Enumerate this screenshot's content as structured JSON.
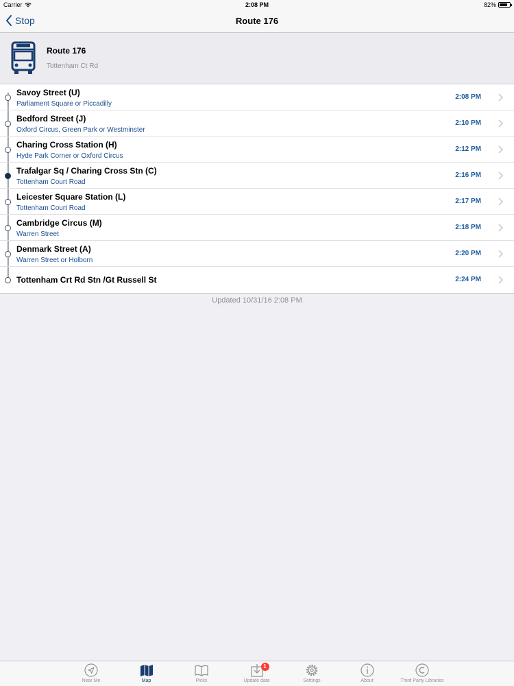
{
  "status_bar": {
    "carrier": "Carrier",
    "time": "2:08 PM",
    "battery_percent": "82%",
    "battery_level": 0.82
  },
  "nav": {
    "back_label": "Stop",
    "title": "Route 176"
  },
  "route": {
    "name": "Route 176",
    "destination": "Tottenham Ct Rd",
    "icon": "bus-icon"
  },
  "stops": [
    {
      "name": "Savoy Street (U)",
      "towards": "Parliament Square or Piccadilly",
      "time": "2:08 PM"
    },
    {
      "name": "Bedford Street (J)",
      "towards": "Oxford Circus, Green Park or Westminster",
      "time": "2:10 PM"
    },
    {
      "name": "Charing Cross Station (H)",
      "towards": "Hyde Park Corner or Oxford Circus",
      "time": "2:12 PM"
    },
    {
      "name": "Trafalgar Sq / Charing Cross Stn (C)",
      "towards": "Tottenham Court Road",
      "time": "2:16 PM",
      "current": true
    },
    {
      "name": "Leicester Square Station (L)",
      "towards": "Tottenham Court Road",
      "time": "2:17 PM"
    },
    {
      "name": "Cambridge Circus (M)",
      "towards": "Warren Street",
      "time": "2:18 PM"
    },
    {
      "name": "Denmark Street (A)",
      "towards": "Warren Street or Holborn",
      "time": "2:20 PM"
    },
    {
      "name": "Tottenham Crt Rd Stn /Gt Russell St",
      "towards": "",
      "time": "2:24 PM"
    }
  ],
  "updated_text": "Updated 10/31/16 2:08 PM",
  "tabs": [
    {
      "label": "Near Me",
      "icon": "location-arrow-icon"
    },
    {
      "label": "Map",
      "icon": "map-icon",
      "active": true
    },
    {
      "label": "Picks",
      "icon": "book-icon"
    },
    {
      "label": "Update data",
      "icon": "download-icon",
      "badge": "1"
    },
    {
      "label": "Settings",
      "icon": "gear-icon"
    },
    {
      "label": "About",
      "icon": "info-icon"
    },
    {
      "label": "Third Party Libraries",
      "icon": "copyright-icon"
    }
  ],
  "colors": {
    "accent": "#1a4d8f",
    "time_blue": "#1a5c9e",
    "badge_red": "#ff3b30",
    "background": "#efeff4"
  }
}
